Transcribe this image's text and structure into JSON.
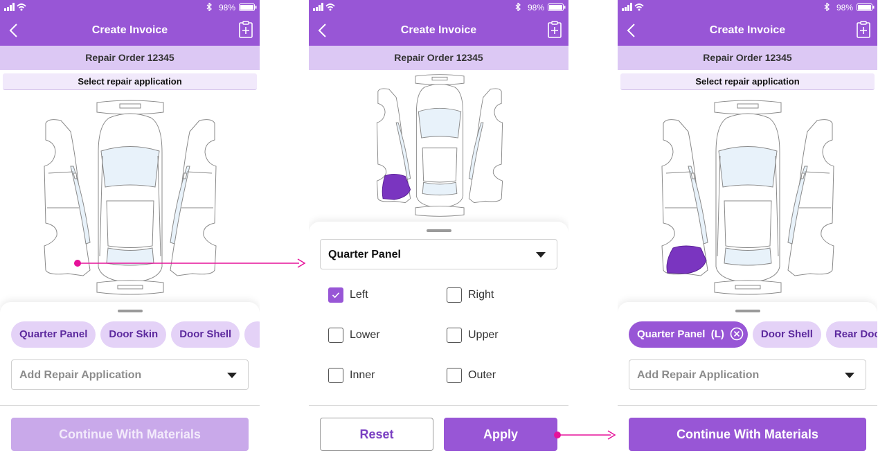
{
  "colors": {
    "accent": "#9856d6",
    "chip_bg": "#e4d2f7",
    "subhead_bg": "#dcc8f4",
    "flow_arrow": "#e6129a",
    "selected_part": "#7a35c0"
  },
  "status": {
    "battery": "98%"
  },
  "header": {
    "title": "Create Invoice",
    "back_icon": "chevron-left-icon",
    "action_icon": "clipboard-plus-icon"
  },
  "order": {
    "label": "Repair Order 12345"
  },
  "select_prompt": "Select repair application",
  "screen1": {
    "chips": [
      "Quarter Panel",
      "Door Skin",
      "Door Shell"
    ],
    "dropdown_placeholder": "Add Repair Application",
    "continue_label": "Continue With Materials",
    "continue_enabled": false
  },
  "screen2": {
    "part": "Quarter Panel",
    "options": [
      {
        "label": "Left",
        "checked": true
      },
      {
        "label": "Right",
        "checked": false
      },
      {
        "label": "Lower",
        "checked": false
      },
      {
        "label": "Upper",
        "checked": false
      },
      {
        "label": "Inner",
        "checked": false
      },
      {
        "label": "Outer",
        "checked": false
      }
    ],
    "reset_label": "Reset",
    "apply_label": "Apply"
  },
  "screen3": {
    "active_chip": {
      "name": "Quarter Panel",
      "side": "(L)"
    },
    "chips": [
      "Door Shell",
      "Rear Door"
    ],
    "dropdown_placeholder": "Add Repair Application",
    "continue_label": "Continue With Materials",
    "continue_enabled": true
  }
}
